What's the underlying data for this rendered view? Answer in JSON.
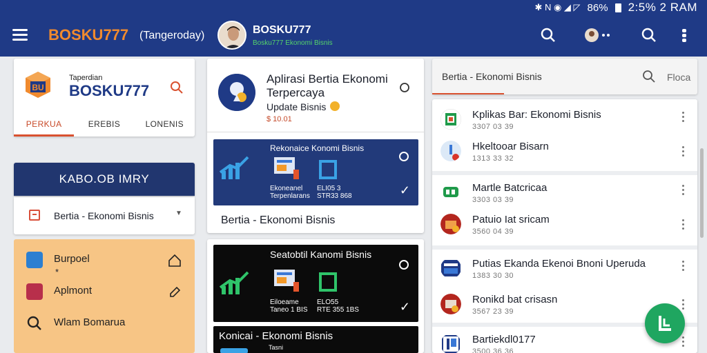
{
  "status_bar": {
    "indicators": "✱ N ◉ ◢ ◸",
    "battery": "86%",
    "time": "2:5% 2 RAM"
  },
  "app_bar": {
    "brand": "BOSKU777",
    "brand_subtitle": "(Tangeroday)",
    "profile_name": "BOSKU777",
    "profile_subtitle": "Bosku777 Ekonomi Bisnis"
  },
  "logo_card": {
    "small_text": "Taperdian",
    "big_text": "BOSKU777",
    "tabs": [
      "PERKUA",
      "EREBIS",
      "LONENIS"
    ]
  },
  "category_header": "KABO.OB IMRY",
  "dropdown": {
    "selected": "Bertia - Ekonomi Bisnis"
  },
  "shortcut_items": [
    {
      "label": "Burpoel",
      "sub": "*"
    },
    {
      "label": "Aplmont",
      "sub": ""
    },
    {
      "label": "Wlam Bomarua",
      "sub": ""
    }
  ],
  "app_card": {
    "title": "Aplirasi Bertia Ekonomi Terpercaya",
    "update": "Update Bisnis",
    "price": "$ 10.01",
    "promo": {
      "title": "Rekonaice Konomi Bisnis",
      "col1": [
        "Ekoneanel",
        "Terpenlarans"
      ],
      "col2": [
        "ELI05 3",
        "STR33 868"
      ]
    },
    "footer": "Bertia - Ekonomi Bisnis"
  },
  "promo_dark": {
    "title": "Seatobtil Kanomi Bisnis",
    "col1": [
      "Eiloeame",
      "Taneo 1 BIS"
    ],
    "col2": [
      "ELO55",
      "RTE 355 1BS"
    ]
  },
  "promo_bottom": {
    "title": "Konicai - Ekonomi Bisnis",
    "sub": "Tasni"
  },
  "search": {
    "value": "Bertia - Ekonomi Bisnis",
    "extra": "Floca"
  },
  "list_items": [
    {
      "title": "Kplikas Bar: Ekonomi Bisnis",
      "sub": "3307 03 39"
    },
    {
      "title": "Hkeltooar Bisarn",
      "sub": "1313 33 32"
    },
    {
      "title": "Martle Batcricaa",
      "sub": "3303 03 39"
    },
    {
      "title": "Patuio Iat sricam",
      "sub": "3560 04 39"
    },
    {
      "title": "Putias Ekanda Ekenoi Bnoni Uperuda",
      "sub": "1383 30 30"
    },
    {
      "title": "Ronikd bat crisasn",
      "sub": "3567 23 39"
    },
    {
      "title": "Bartiekdl0177",
      "sub": "3500 36 36"
    }
  ],
  "colors": {
    "app_bar": "#1f3a86",
    "brand_orange": "#f08a2e",
    "accent_red": "#d9512f",
    "category_header": "#21366f",
    "orange_card": "#f7c585",
    "promo_navy": "#223a7a",
    "promo_black": "#0b0b0b",
    "fab_green": "#1fa660"
  }
}
